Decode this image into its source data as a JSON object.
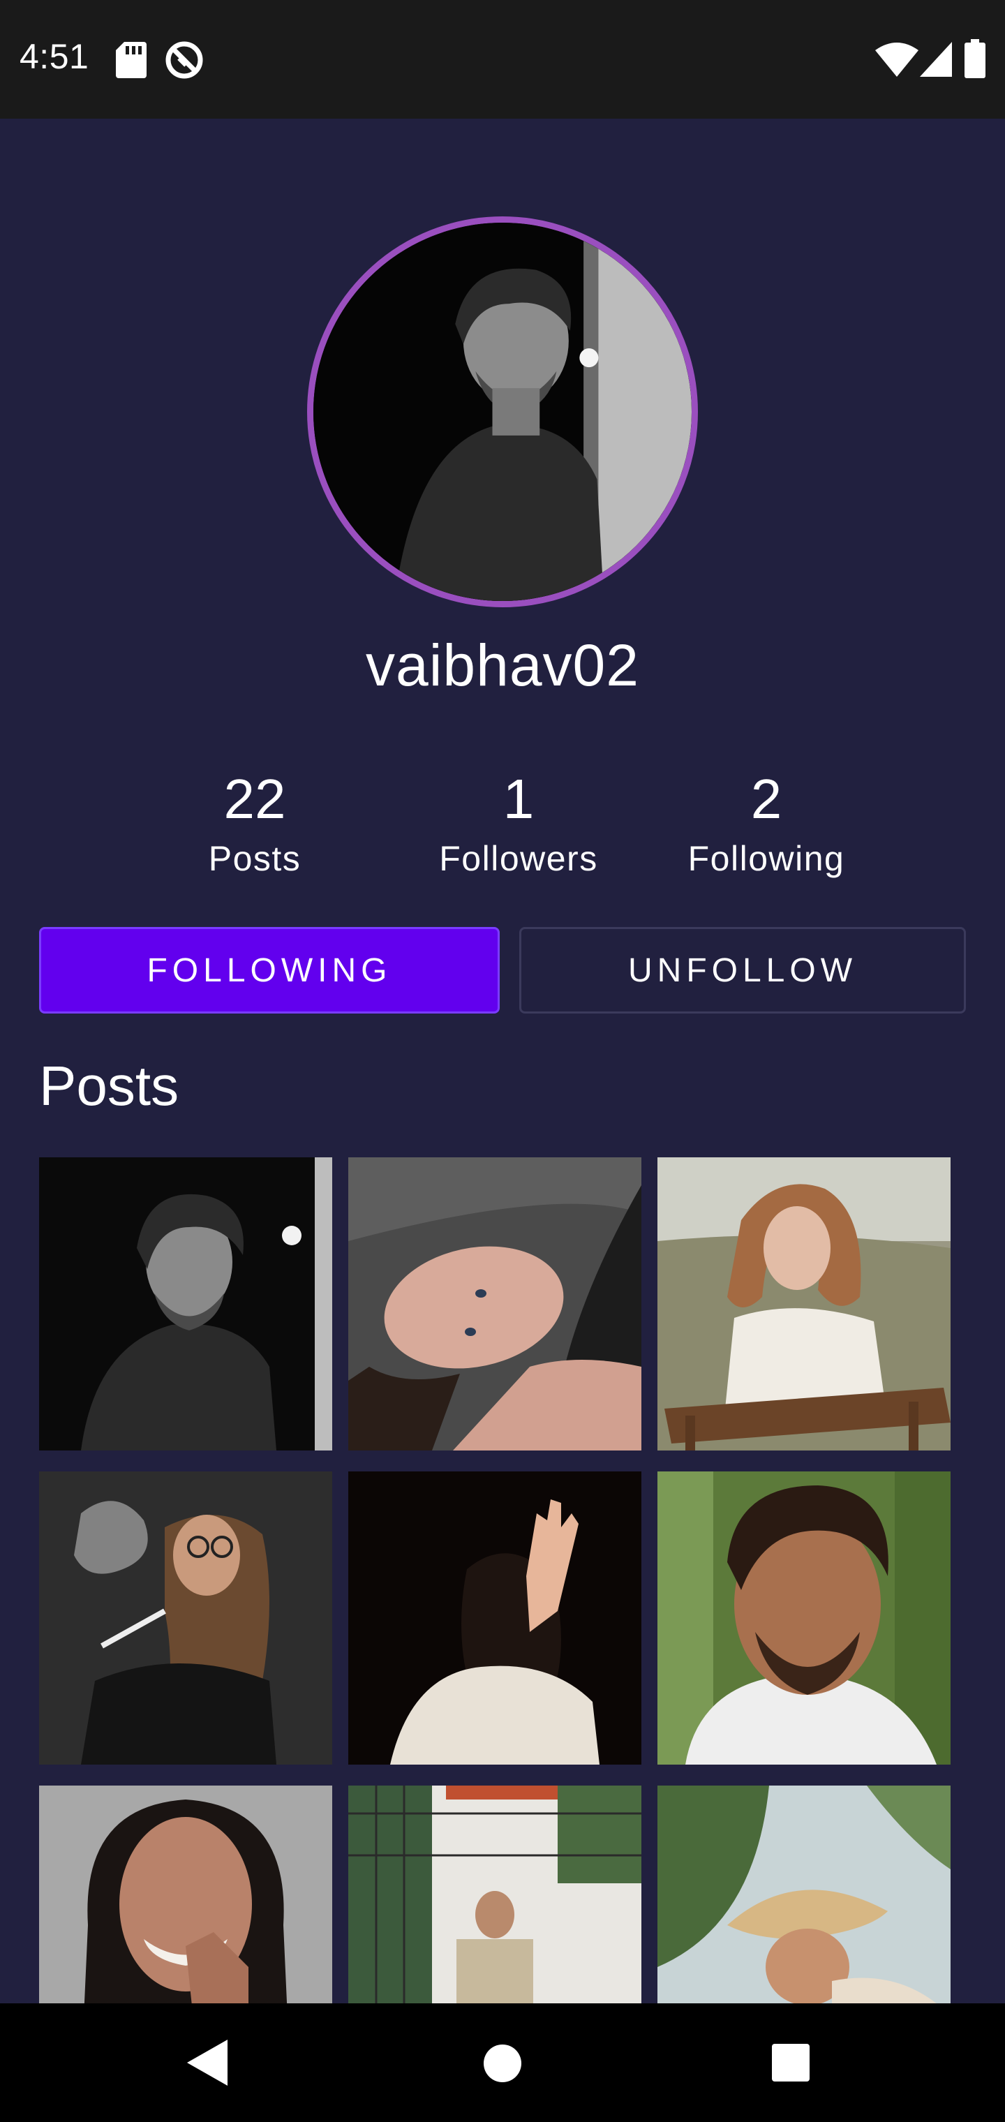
{
  "status_bar": {
    "time": "4:51",
    "icons": [
      "sd-card-icon",
      "sync-icon",
      "wifi-icon",
      "signal-icon",
      "battery-icon"
    ]
  },
  "profile": {
    "username": "vaibhav02",
    "avatar_ring_color": "#9a4fbf",
    "stats": [
      {
        "count": "22",
        "label": "Posts"
      },
      {
        "count": "1",
        "label": "Followers"
      },
      {
        "count": "2",
        "label": "Following"
      }
    ]
  },
  "actions": {
    "following_label": "FOLLOWING",
    "unfollow_label": "UNFOLLOW",
    "accent_color": "#6200ee"
  },
  "posts": {
    "title": "Posts",
    "items": [
      "man-black-white-portrait",
      "woman-lying-on-ground",
      "woman-in-field-on-chair",
      "woman-smoking-glasses",
      "person-hand-covering-face",
      "man-curly-hair-portrait",
      "woman-smiling-finger-lips",
      "man-standing-by-wall",
      "woman-sun-hat-guitar"
    ]
  },
  "nav_bar": {
    "buttons": [
      "back-icon",
      "home-icon",
      "recents-icon"
    ]
  },
  "colors": {
    "background": "#21203f",
    "status_bar": "#1a1a1a",
    "nav_bar": "#000000"
  }
}
